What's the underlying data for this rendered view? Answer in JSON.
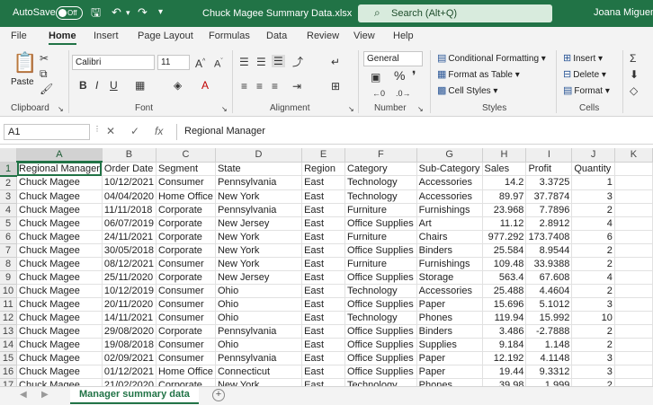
{
  "titlebar": {
    "autosave_label": "AutoSave",
    "autosave_state": "Off",
    "filename": "Chuck Magee Summary Data.xlsx",
    "dropdown_glyph": "▾",
    "search_placeholder": "Search (Alt+Q)",
    "user": "Joana Miguens",
    "accent": "#217346"
  },
  "tabs": [
    "File",
    "Home",
    "Insert",
    "Page Layout",
    "Formulas",
    "Data",
    "Review",
    "View",
    "Help"
  ],
  "active_tab": "Home",
  "ribbon": {
    "clipboard": {
      "label": "Clipboard",
      "paste": "Paste"
    },
    "font": {
      "label": "Font",
      "name": "Calibri",
      "size": "11"
    },
    "alignment": {
      "label": "Alignment"
    },
    "number": {
      "label": "Number",
      "format": "General"
    },
    "styles": {
      "label": "Styles",
      "conditional": "Conditional Formatting",
      "format_table": "Format as Table",
      "cell_styles": "Cell Styles"
    },
    "cells": {
      "label": "Cells",
      "insert": "Insert",
      "delete": "Delete",
      "format": "Format"
    }
  },
  "formula_bar": {
    "name_box": "A1",
    "content": "Regional Manager"
  },
  "grid": {
    "columns": [
      "A",
      "B",
      "C",
      "D",
      "E",
      "F",
      "G",
      "H",
      "I",
      "J",
      "K"
    ],
    "header": [
      "Regional Manager",
      "Order Date",
      "Segment",
      "State",
      "Region",
      "Category",
      "Sub-Category",
      "Sales",
      "Profit",
      "Quantity",
      ""
    ],
    "rows": [
      [
        "Chuck Magee",
        "10/12/2021",
        "Consumer",
        "Pennsylvania",
        "East",
        "Technology",
        "Accessories",
        "14.2",
        "3.3725",
        "1",
        ""
      ],
      [
        "Chuck Magee",
        "04/04/2020",
        "Home Office",
        "New York",
        "East",
        "Technology",
        "Accessories",
        "89.97",
        "37.7874",
        "3",
        ""
      ],
      [
        "Chuck Magee",
        "11/11/2018",
        "Corporate",
        "Pennsylvania",
        "East",
        "Furniture",
        "Furnishings",
        "23.968",
        "7.7896",
        "2",
        ""
      ],
      [
        "Chuck Magee",
        "06/07/2019",
        "Corporate",
        "New Jersey",
        "East",
        "Office Supplies",
        "Art",
        "11.12",
        "2.8912",
        "4",
        ""
      ],
      [
        "Chuck Magee",
        "24/11/2021",
        "Corporate",
        "New York",
        "East",
        "Furniture",
        "Chairs",
        "977.292",
        "173.7408",
        "6",
        ""
      ],
      [
        "Chuck Magee",
        "30/05/2018",
        "Corporate",
        "New York",
        "East",
        "Office Supplies",
        "Binders",
        "25.584",
        "8.9544",
        "2",
        ""
      ],
      [
        "Chuck Magee",
        "08/12/2021",
        "Consumer",
        "New York",
        "East",
        "Furniture",
        "Furnishings",
        "109.48",
        "33.9388",
        "2",
        ""
      ],
      [
        "Chuck Magee",
        "25/11/2020",
        "Corporate",
        "New Jersey",
        "East",
        "Office Supplies",
        "Storage",
        "563.4",
        "67.608",
        "4",
        ""
      ],
      [
        "Chuck Magee",
        "10/12/2019",
        "Consumer",
        "Ohio",
        "East",
        "Technology",
        "Accessories",
        "25.488",
        "4.4604",
        "2",
        ""
      ],
      [
        "Chuck Magee",
        "20/11/2020",
        "Consumer",
        "Ohio",
        "East",
        "Office Supplies",
        "Paper",
        "15.696",
        "5.1012",
        "3",
        ""
      ],
      [
        "Chuck Magee",
        "14/11/2021",
        "Consumer",
        "Ohio",
        "East",
        "Technology",
        "Phones",
        "119.94",
        "15.992",
        "10",
        ""
      ],
      [
        "Chuck Magee",
        "29/08/2020",
        "Corporate",
        "Pennsylvania",
        "East",
        "Office Supplies",
        "Binders",
        "3.486",
        "-2.7888",
        "2",
        ""
      ],
      [
        "Chuck Magee",
        "19/08/2018",
        "Consumer",
        "Ohio",
        "East",
        "Office Supplies",
        "Supplies",
        "9.184",
        "1.148",
        "2",
        ""
      ],
      [
        "Chuck Magee",
        "02/09/2021",
        "Consumer",
        "Pennsylvania",
        "East",
        "Office Supplies",
        "Paper",
        "12.192",
        "4.1148",
        "3",
        ""
      ],
      [
        "Chuck Magee",
        "01/12/2021",
        "Home Office",
        "Connecticut",
        "East",
        "Office Supplies",
        "Paper",
        "19.44",
        "9.3312",
        "3",
        ""
      ],
      [
        "Chuck Magee",
        "21/02/2020",
        "Corporate",
        "New York",
        "East",
        "Technology",
        "Phones",
        "39.98",
        "1.999",
        "2",
        ""
      ]
    ]
  },
  "sheets": [
    "Manager summary data"
  ],
  "add_sheet_glyph": "+"
}
